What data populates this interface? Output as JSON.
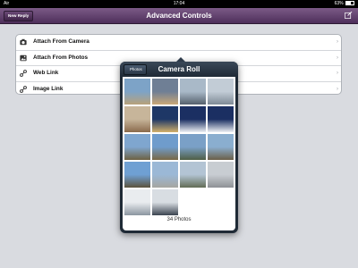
{
  "status": {
    "carrier": "Air",
    "time": "17:04",
    "battery": "63%"
  },
  "navbar": {
    "title": "Advanced Controls",
    "new_reply_label": "New Reply"
  },
  "rows": [
    {
      "label": "Attach From Camera",
      "icon": "camera-icon"
    },
    {
      "label": "Attach From Photos",
      "icon": "photos-icon"
    },
    {
      "label": "Web Link",
      "icon": "link-icon"
    },
    {
      "label": "Image Link",
      "icon": "image-link-icon"
    }
  ],
  "popover": {
    "back_label": "Photos",
    "title": "Camera Roll",
    "photo_count": "34 Photos"
  },
  "thumbnails": [
    {
      "c1": "#7da3c7",
      "c2": "#b8a27a"
    },
    {
      "c1": "#6f7f95",
      "c2": "#c9a777"
    },
    {
      "c1": "#a9b9c8",
      "c2": "#55606c"
    },
    {
      "c1": "#c2ccd6",
      "c2": "#7e8a96"
    },
    {
      "c1": "#c7b59a",
      "c2": "#8a6a4c"
    },
    {
      "c1": "#1e3766",
      "c2": "#d2b06a"
    },
    {
      "c1": "#1b2f62",
      "c2": "#eef0f4"
    },
    {
      "c1": "#1b2f62",
      "c2": "#eef0f4"
    },
    {
      "c1": "#7fa6cf",
      "c2": "#6d6142"
    },
    {
      "c1": "#6f9ccc",
      "c2": "#786744"
    },
    {
      "c1": "#7aa0c7",
      "c2": "#4e5e45"
    },
    {
      "c1": "#8aaecf",
      "c2": "#6b5f47"
    },
    {
      "c1": "#6fa0d3",
      "c2": "#5c533d"
    },
    {
      "c1": "#9bb8d6",
      "c2": "#a6a6a0"
    },
    {
      "c1": "#b3c4d4",
      "c2": "#626c55"
    },
    {
      "c1": "#c8cdd2",
      "c2": "#8e9195"
    },
    {
      "c1": "#e9ecef",
      "c2": "#8b95a0"
    },
    {
      "c1": "#d8dde2",
      "c2": "#3b4450"
    }
  ]
}
